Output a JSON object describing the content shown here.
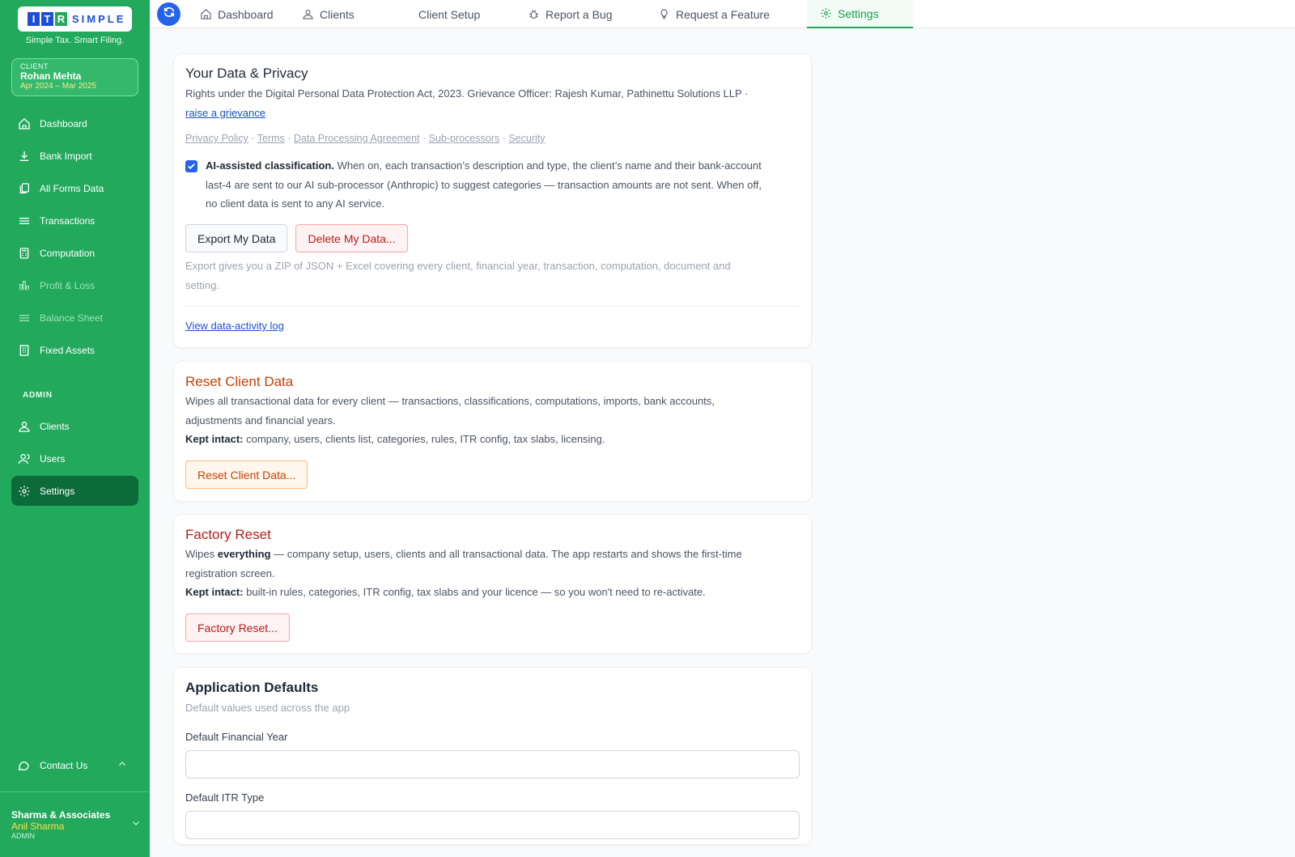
{
  "brand": {
    "logo_letters": [
      "I",
      "T",
      "R"
    ],
    "logo_rest": "SIMPLE",
    "tagline": "Simple Tax. Smart Filing.",
    "colors": {
      "sidebar": "#22a95c",
      "active": "#0d6b3a",
      "logo_blue": "#1d4ed8",
      "logo_green": "#22a95c"
    }
  },
  "client": {
    "label": "CLIENT",
    "name": "Rohan Mehta",
    "period": "Apr 2024 – Mar 2025"
  },
  "sidebar": {
    "items": [
      {
        "label": "Dashboard",
        "icon": "home-icon"
      },
      {
        "label": "Bank Import",
        "icon": "download-icon"
      },
      {
        "label": "All Forms Data",
        "icon": "copy-icon"
      },
      {
        "label": "Transactions",
        "icon": "menu-icon"
      },
      {
        "label": "Computation",
        "icon": "calculator-icon"
      },
      {
        "label": "Profit & Loss",
        "icon": "bar-chart-icon",
        "disabled": true
      },
      {
        "label": "Balance Sheet",
        "icon": "menu-icon",
        "disabled": true
      },
      {
        "label": "Fixed Assets",
        "icon": "building-icon"
      }
    ],
    "admin_heading": "ADMIN",
    "admin_items": [
      {
        "label": "Clients",
        "icon": "clients-icon"
      },
      {
        "label": "Users",
        "icon": "users-icon"
      },
      {
        "label": "Settings",
        "icon": "gear-icon",
        "active": true
      }
    ],
    "contact_label": "Contact Us",
    "footer": {
      "firm": "Sharma & Associates",
      "user": "Anil Sharma",
      "role": "ADMIN"
    }
  },
  "topnav": {
    "tabs": [
      {
        "label": "Dashboard",
        "icon": "home-icon"
      },
      {
        "label": "Clients",
        "icon": "clients-icon"
      },
      {
        "label": "Client Setup",
        "icon": ""
      },
      {
        "label": "Report a Bug",
        "icon": "bug-icon"
      },
      {
        "label": "Request a Feature",
        "icon": "lightbulb-icon"
      },
      {
        "label": "Settings",
        "icon": "gear-icon",
        "active": true
      }
    ]
  },
  "privacy": {
    "title": "Your Data & Privacy",
    "rights_text": "Rights under the Digital Personal Data Protection Act, 2023. Grievance Officer: Rajesh Kumar, Pathinettu Solutions LLP ·",
    "grievance_link": "raise a grievance",
    "legal_links": [
      "Privacy Policy",
      "Terms",
      "Data Processing Agreement",
      "Sub-processors",
      "Security"
    ],
    "legal_sep": "·",
    "ai_checked": true,
    "ai_title": "AI-assisted classification.",
    "ai_text_1": "When on, each transaction’s description and type, the client’s name and their bank-account",
    "ai_text_2": "last-4 are sent to our AI sub-processor (Anthropic) to suggest categories — transaction amounts are not sent. When off,",
    "ai_text_3": "no client data is sent to any AI service.",
    "export_button": "Export My Data",
    "delete_button": "Delete My Data...",
    "export_hint_1": "Export gives you a ZIP of JSON + Excel covering every client, financial year, transaction, computation, document and",
    "export_hint_2": "setting.",
    "activity_link": "View data-activity log"
  },
  "reset": {
    "title": "Reset Client Data",
    "desc_1": "Wipes all transactional data for every client — transactions, classifications, computations, imports, bank accounts,",
    "desc_2": "adjustments and financial years.",
    "kept_label": "Kept intact:",
    "kept_text": "company, users, clients list, categories, rules, ITR config, tax slabs, licensing.",
    "button": "Reset Client Data..."
  },
  "factory": {
    "title": "Factory Reset",
    "desc_pre": "Wipes",
    "desc_bold": "everything",
    "desc_1": "— company setup, users, clients and all transactional data. The app restarts and shows the first-time",
    "desc_2": "registration screen.",
    "kept_label": "Kept intact:",
    "kept_text": "built-in rules, categories, ITR config, tax slabs and your licence — so you won't need to re-activate.",
    "button": "Factory Reset..."
  },
  "defaults": {
    "title": "Application Defaults",
    "subtitle": "Default values used across the app",
    "fy_label": "Default Financial Year",
    "fy_value": "",
    "itr_label": "Default ITR Type",
    "itr_value": ""
  }
}
